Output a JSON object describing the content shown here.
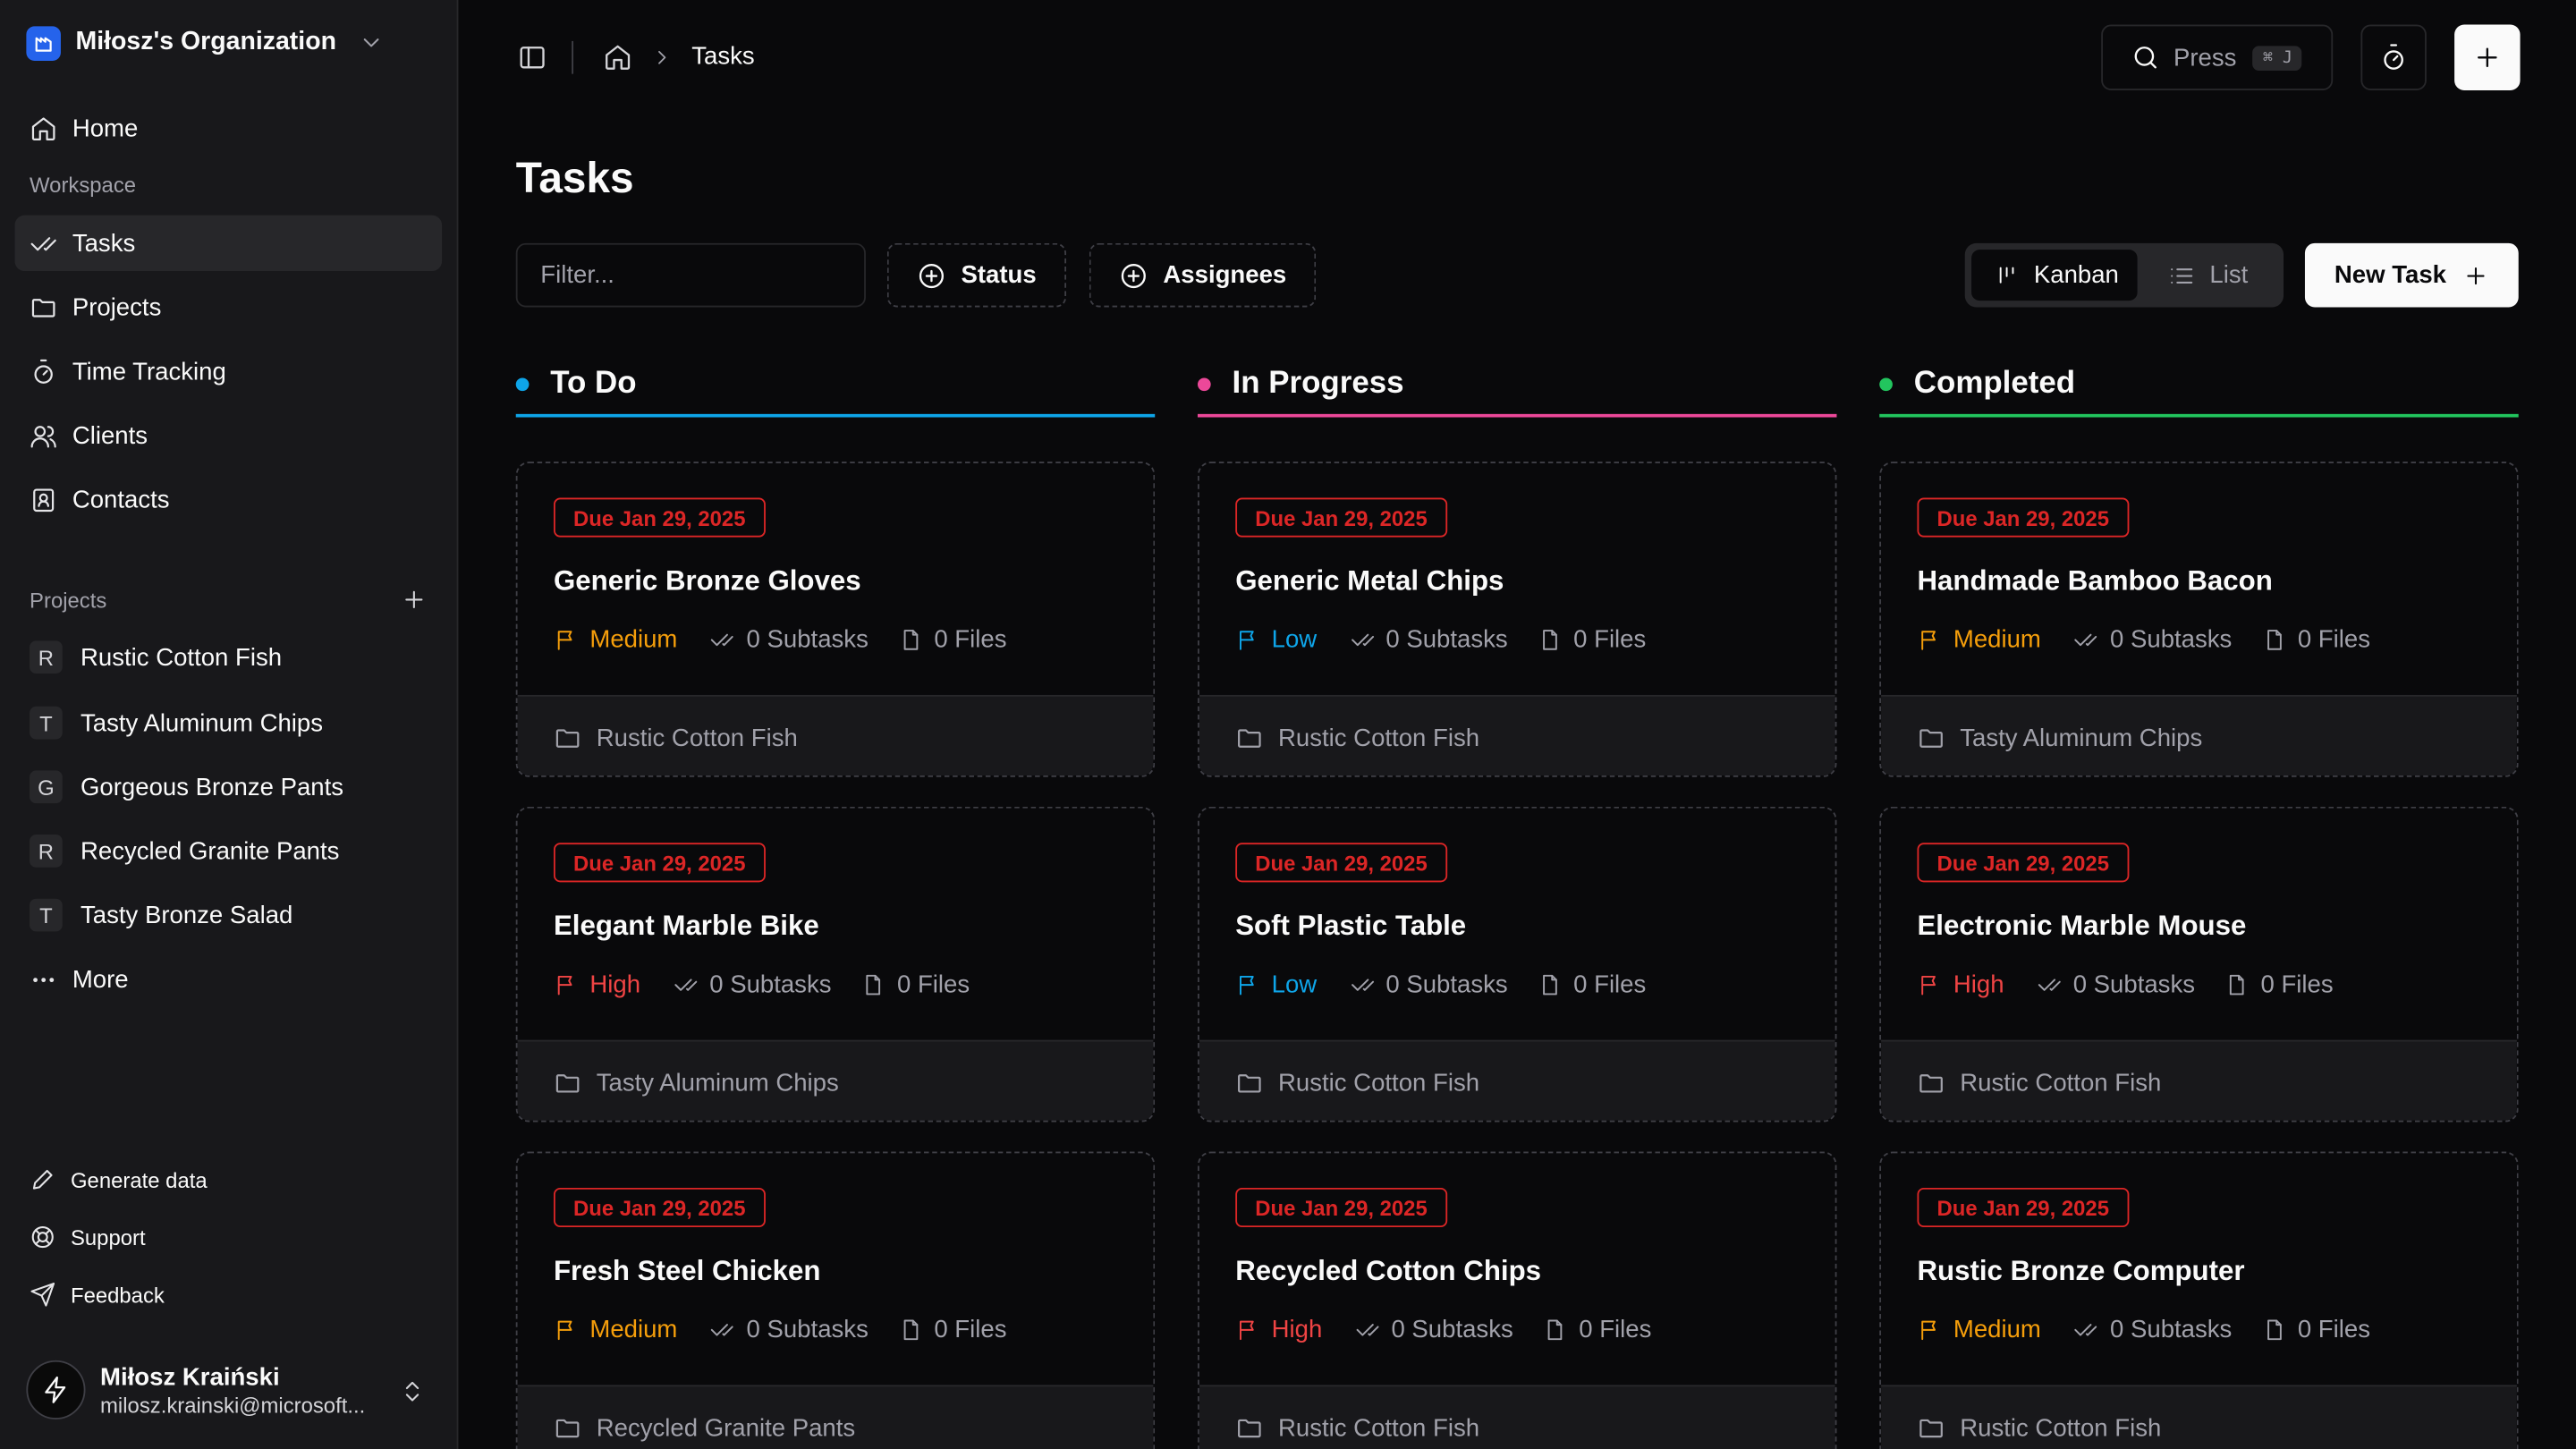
{
  "org": {
    "name": "Miłosz's Organization"
  },
  "nav": {
    "home": "Home",
    "workspace_label": "Workspace",
    "tasks": "Tasks",
    "projects": "Projects",
    "time_tracking": "Time Tracking",
    "clients": "Clients",
    "contacts": "Contacts"
  },
  "projects_section": {
    "label": "Projects",
    "items": [
      {
        "letter": "R",
        "name": "Rustic Cotton Fish"
      },
      {
        "letter": "T",
        "name": "Tasty Aluminum Chips"
      },
      {
        "letter": "G",
        "name": "Gorgeous Bronze Pants"
      },
      {
        "letter": "R",
        "name": "Recycled Granite Pants"
      },
      {
        "letter": "T",
        "name": "Tasty Bronze Salad"
      }
    ],
    "more": "More"
  },
  "bottom": {
    "generate": "Generate data",
    "support": "Support",
    "feedback": "Feedback"
  },
  "user": {
    "name": "Miłosz Kraiński",
    "email": "milosz.krainski@microsoft..."
  },
  "breadcrumb": {
    "current": "Tasks"
  },
  "search": {
    "label": "Press",
    "shortcut": "⌘ J"
  },
  "page": {
    "title": "Tasks"
  },
  "toolbar": {
    "filter_placeholder": "Filter...",
    "status": "Status",
    "assignees": "Assignees",
    "kanban": "Kanban",
    "list": "List",
    "new_task": "New Task"
  },
  "colors": {
    "todo": "#0ea5e9",
    "in_progress": "#ec4899",
    "completed": "#22c55e",
    "high": "#ef4444",
    "medium": "#f59e0b",
    "low": "#0ea5e9",
    "due": "#dc2626"
  },
  "columns": [
    {
      "name": "To Do",
      "color": "#0ea5e9",
      "cards": [
        {
          "due": "Due Jan 29, 2025",
          "title": "Generic Bronze Gloves",
          "priority": "Medium",
          "subtasks": "0 Subtasks",
          "files": "0 Files",
          "project": "Rustic Cotton Fish"
        },
        {
          "due": "Due Jan 29, 2025",
          "title": "Elegant Marble Bike",
          "priority": "High",
          "subtasks": "0 Subtasks",
          "files": "0 Files",
          "project": "Tasty Aluminum Chips"
        },
        {
          "due": "Due Jan 29, 2025",
          "title": "Fresh Steel Chicken",
          "priority": "Medium",
          "subtasks": "0 Subtasks",
          "files": "0 Files",
          "project": "Recycled Granite Pants"
        }
      ]
    },
    {
      "name": "In Progress",
      "color": "#ec4899",
      "cards": [
        {
          "due": "Due Jan 29, 2025",
          "title": "Generic Metal Chips",
          "priority": "Low",
          "subtasks": "0 Subtasks",
          "files": "0 Files",
          "project": "Rustic Cotton Fish"
        },
        {
          "due": "Due Jan 29, 2025",
          "title": "Soft Plastic Table",
          "priority": "Low",
          "subtasks": "0 Subtasks",
          "files": "0 Files",
          "project": "Rustic Cotton Fish"
        },
        {
          "due": "Due Jan 29, 2025",
          "title": "Recycled Cotton Chips",
          "priority": "High",
          "subtasks": "0 Subtasks",
          "files": "0 Files",
          "project": "Rustic Cotton Fish"
        }
      ]
    },
    {
      "name": "Completed",
      "color": "#22c55e",
      "cards": [
        {
          "due": "Due Jan 29, 2025",
          "title": "Handmade Bamboo Bacon",
          "priority": "Medium",
          "subtasks": "0 Subtasks",
          "files": "0 Files",
          "project": "Tasty Aluminum Chips"
        },
        {
          "due": "Due Jan 29, 2025",
          "title": "Electronic Marble Mouse",
          "priority": "High",
          "subtasks": "0 Subtasks",
          "files": "0 Files",
          "project": "Rustic Cotton Fish"
        },
        {
          "due": "Due Jan 29, 2025",
          "title": "Rustic Bronze Computer",
          "priority": "Medium",
          "subtasks": "0 Subtasks",
          "files": "0 Files",
          "project": "Rustic Cotton Fish"
        }
      ]
    }
  ]
}
